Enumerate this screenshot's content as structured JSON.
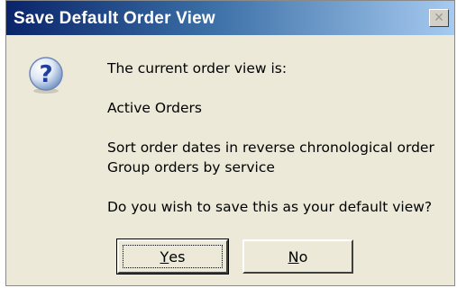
{
  "dialog": {
    "title": "Save Default Order View",
    "close_glyph": "✕"
  },
  "message": {
    "intro": "The current order view is:",
    "view_name": "Active Orders",
    "sort_line": "Sort order dates in reverse chronological order",
    "group_line": "Group orders by service",
    "question": "Do you wish to save this as your default view?"
  },
  "buttons": {
    "yes_first": "Y",
    "yes_rest": "es",
    "no_first": "N",
    "no_rest": "o"
  },
  "icons": {
    "question": "question-icon"
  },
  "colors": {
    "title_bar_start": "#0a246a",
    "title_bar_end": "#a6caf0",
    "dialog_bg": "#ece9d8"
  }
}
